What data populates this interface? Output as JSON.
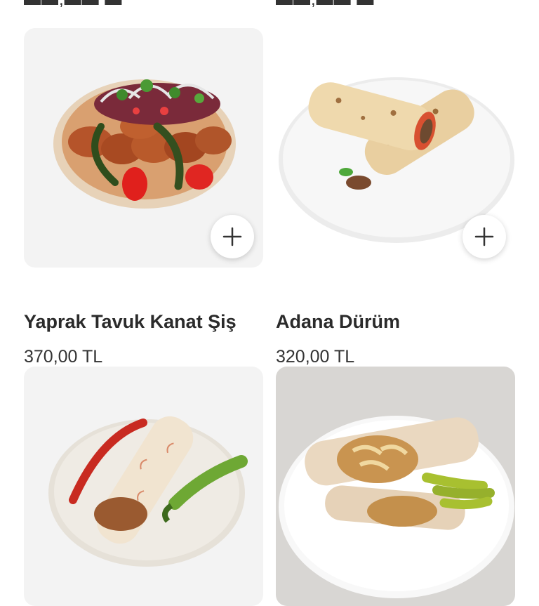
{
  "products": [
    {
      "name": "Yaprak Tavuk Kanat Şiş",
      "price": "370,00 TL",
      "image": "chicken-wing-skewer-plate-image",
      "add_icon": "plus-icon"
    },
    {
      "name": "Adana Dürüm",
      "price": "320,00 TL",
      "image": "adana-wrap-plate-image",
      "add_icon": "plus-icon"
    },
    {
      "name": "",
      "price": "",
      "image": "chicken-wrap-with-peppers-image",
      "add_icon": "plus-icon"
    },
    {
      "name": "",
      "price": "",
      "image": "doner-wrap-with-pickled-peppers-image",
      "add_icon": "plus-icon"
    }
  ],
  "colors": {
    "card_bg": "#f4f4f4",
    "text": "#2b2b2b",
    "button_bg": "#ffffff"
  }
}
